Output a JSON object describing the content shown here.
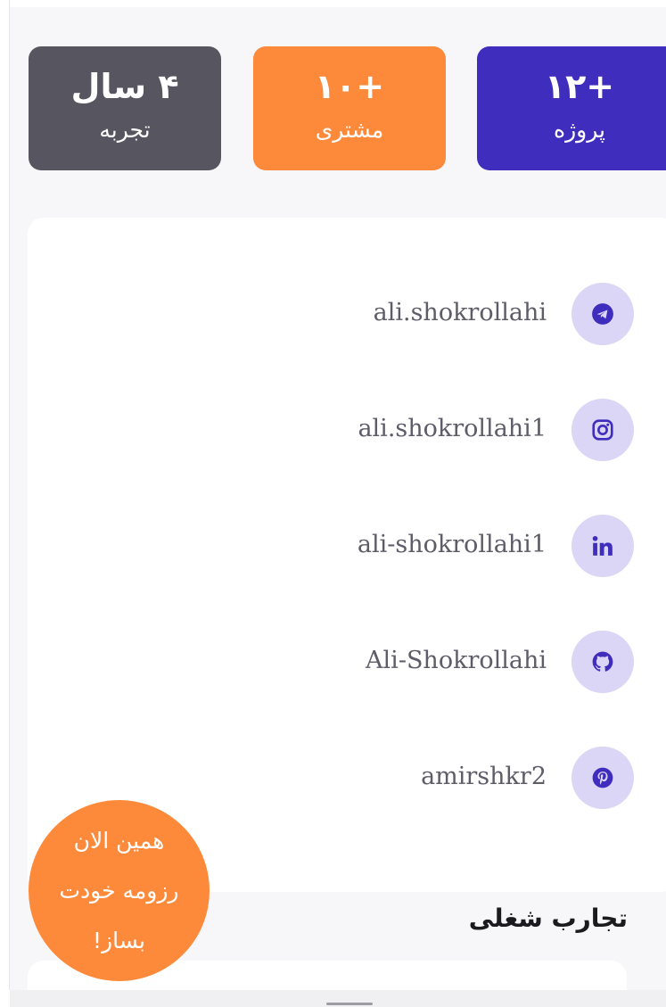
{
  "stats": [
    {
      "value": "۴ سال",
      "label": "تجربه",
      "color": "#57555f"
    },
    {
      "value": "+۱۰",
      "label": "مشتری",
      "color": "#fd8a3a"
    },
    {
      "value": "+۱۲",
      "label": "پروژه",
      "color": "#3f2dbd"
    }
  ],
  "social": {
    "icon_bg": "#dbd6f5",
    "icon_color": "#3f2dbd",
    "items": [
      {
        "icon": "telegram-icon",
        "handle": "ali.shokrollahi"
      },
      {
        "icon": "instagram-icon",
        "handle": "ali.shokrollahi1"
      },
      {
        "icon": "linkedin-icon",
        "handle": "ali-shokrollahi1"
      },
      {
        "icon": "github-icon",
        "handle": "Ali-Shokrollahi"
      },
      {
        "icon": "pinterest-icon",
        "handle": "amirshkr2"
      }
    ]
  },
  "experience": {
    "title": "تجارب شغلی"
  },
  "cta": {
    "line1": "همین الان",
    "line2": "رزومه خودت",
    "line3": "بساز!",
    "color": "#fd8a3a"
  }
}
